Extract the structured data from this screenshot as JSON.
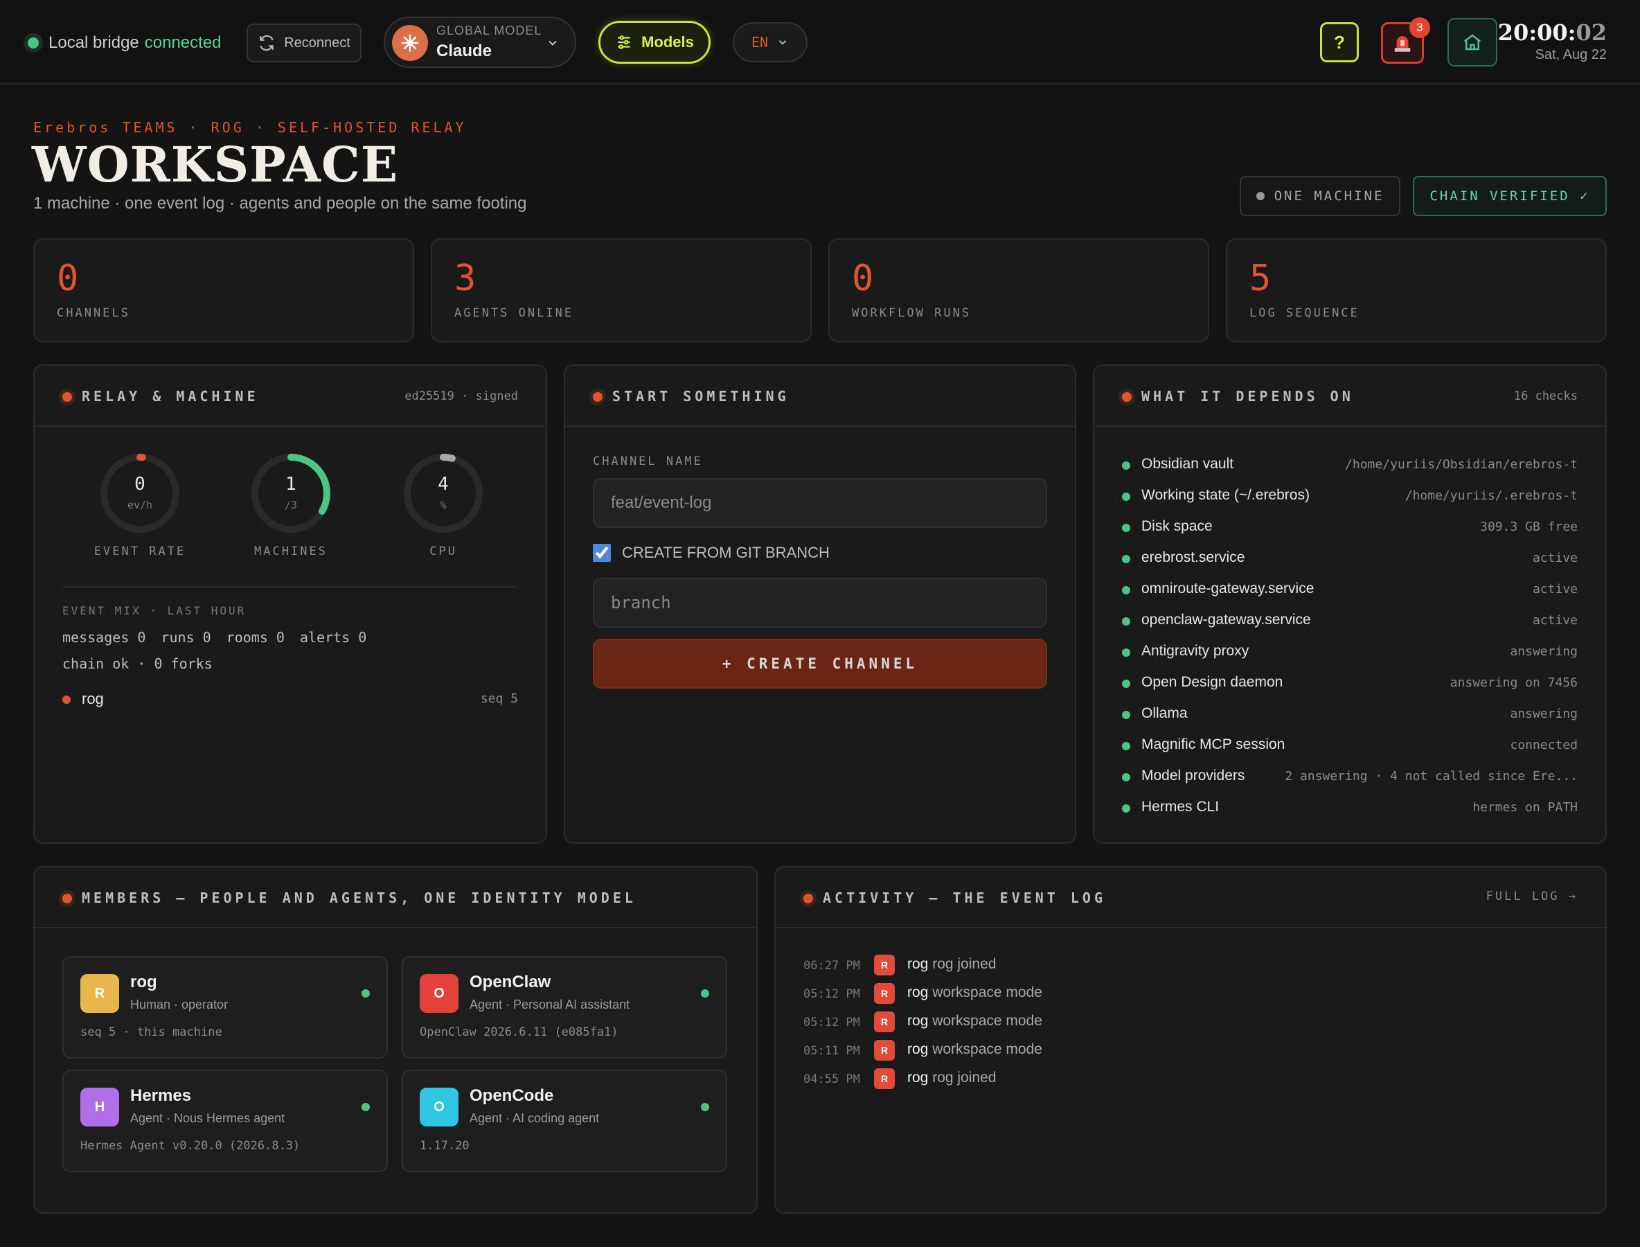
{
  "topbar": {
    "bridge_prefix": "Local bridge",
    "bridge_status": "connected",
    "reconnect_label": "Reconnect",
    "model_label": "GLOBAL MODEL",
    "model_value": "Claude",
    "models_label": "Models",
    "lang_label": "EN",
    "help_label": "?",
    "alert_count": "3",
    "clock_hm": "20:00:",
    "clock_sec": "02",
    "clock_date": "Sat, Aug 22"
  },
  "header": {
    "eyebrow": "Erebros TEAMS · ROG · SELF-HOSTED RELAY",
    "title": "WORKSPACE",
    "subtitle": "1 machine · one event log · agents and people on the same footing",
    "chip_machine": "ONE MACHINE",
    "chip_chain": "CHAIN VERIFIED ✓"
  },
  "stats": [
    {
      "value": "0",
      "label": "CHANNELS"
    },
    {
      "value": "3",
      "label": "AGENTS ONLINE"
    },
    {
      "value": "0",
      "label": "WORKFLOW RUNS"
    },
    {
      "value": "5",
      "label": "LOG SEQUENCE"
    }
  ],
  "relay": {
    "title": "RELAY & MACHINE",
    "meta": "ed25519 · signed",
    "gauges": [
      {
        "value": "0",
        "unit": "ev/h",
        "label": "EVENT RATE",
        "fraction": 0.01
      },
      {
        "value": "1",
        "unit": "/3",
        "label": "MACHINES",
        "fraction": 0.333
      },
      {
        "value": "4",
        "unit": "%",
        "label": "CPU",
        "fraction": 0.04
      }
    ],
    "mix_label": "EVENT MIX · LAST HOUR",
    "mix": [
      "messages 0",
      "runs 0",
      "rooms 0",
      "alerts 0"
    ],
    "chain": "chain ok · 0 forks",
    "node_name": "rog",
    "node_seq": "seq 5"
  },
  "start": {
    "title": "START SOMETHING",
    "channel_label": "CHANNEL NAME",
    "channel_placeholder": "feat/event-log",
    "git_label": "CREATE FROM GIT BRANCH",
    "branch_placeholder": "branch",
    "create_label": "+ CREATE CHANNEL"
  },
  "depends": {
    "title": "WHAT IT DEPENDS ON",
    "meta": "16 checks",
    "items": [
      {
        "name": "Obsidian vault",
        "value": "/home/yuriis/Obsidian/erebros-t"
      },
      {
        "name": "Working state (~/.erebros)",
        "value": "/home/yuriis/.erebros-t"
      },
      {
        "name": "Disk space",
        "value": "309.3 GB free"
      },
      {
        "name": "erebrost.service",
        "value": "active"
      },
      {
        "name": "omniroute-gateway.service",
        "value": "active"
      },
      {
        "name": "openclaw-gateway.service",
        "value": "active"
      },
      {
        "name": "Antigravity proxy",
        "value": "answering"
      },
      {
        "name": "Open Design daemon",
        "value": "answering on 7456"
      },
      {
        "name": "Ollama",
        "value": "answering"
      },
      {
        "name": "Magnific MCP session",
        "value": "connected"
      },
      {
        "name": "Model providers",
        "value": "2 answering · 4 not called since Ere..."
      },
      {
        "name": "Hermes CLI",
        "value": "hermes on PATH"
      }
    ]
  },
  "members": {
    "title": "MEMBERS — PEOPLE AND AGENTS, ONE IDENTITY MODEL",
    "items": [
      {
        "initial": "R",
        "name": "rog",
        "role": "Human · operator",
        "info": "seq 5 · this machine",
        "color": "#e8b64a"
      },
      {
        "initial": "O",
        "name": "OpenClaw",
        "role": "Agent · Personal AI assistant",
        "info": "OpenClaw 2026.6.11 (e085fa1)",
        "color": "#e4403c"
      },
      {
        "initial": "H",
        "name": "Hermes",
        "role": "Agent · Nous Hermes agent",
        "info": "Hermes Agent v0.20.0 (2026.8.3)",
        "color": "#b06ee8"
      },
      {
        "initial": "O",
        "name": "OpenCode",
        "role": "Agent · AI coding agent",
        "info": "1.17.20",
        "color": "#2ec6e0"
      }
    ]
  },
  "activity": {
    "title": "ACTIVITY — THE EVENT LOG",
    "full_log": "FULL LOG →",
    "items": [
      {
        "time": "06:27 PM",
        "badge": "R",
        "who": "rog",
        "event": "rog joined"
      },
      {
        "time": "05:12 PM",
        "badge": "R",
        "who": "rog",
        "event": "workspace mode"
      },
      {
        "time": "05:12 PM",
        "badge": "R",
        "who": "rog",
        "event": "workspace mode"
      },
      {
        "time": "05:11 PM",
        "badge": "R",
        "who": "rog",
        "event": "workspace mode"
      },
      {
        "time": "04:55 PM",
        "badge": "R",
        "who": "rog",
        "event": "rog joined"
      }
    ]
  }
}
